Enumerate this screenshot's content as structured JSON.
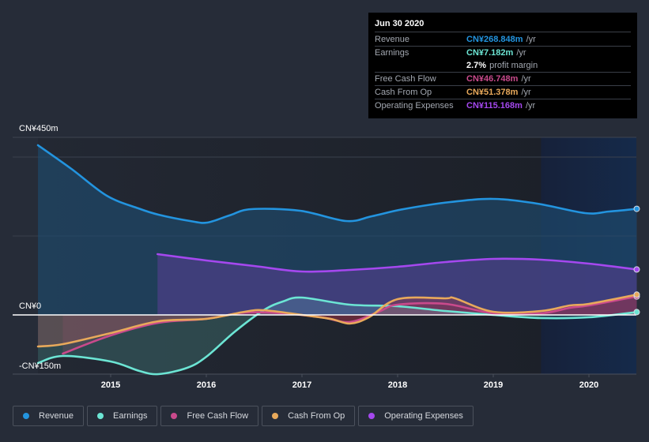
{
  "tooltip": {
    "date": "Jun 30 2020",
    "rows": [
      {
        "label": "Revenue",
        "value": "CN¥268.848m",
        "unit": "/yr",
        "color": "#2394df"
      },
      {
        "label": "Earnings",
        "value": "CN¥7.182m",
        "unit": "/yr",
        "color": "#6ce5d4"
      },
      {
        "label": "",
        "value": "2.7%",
        "unit": "profit margin",
        "color": "#ffffff"
      },
      {
        "label": "Free Cash Flow",
        "value": "CN¥46.748m",
        "unit": "/yr",
        "color": "#c94a8c"
      },
      {
        "label": "Cash From Op",
        "value": "CN¥51.378m",
        "unit": "/yr",
        "color": "#e8a95b"
      },
      {
        "label": "Operating Expenses",
        "value": "CN¥115.168m",
        "unit": "/yr",
        "color": "#a548ef"
      }
    ]
  },
  "legend": [
    {
      "label": "Revenue",
      "color": "#2394df"
    },
    {
      "label": "Earnings",
      "color": "#6ce5d4"
    },
    {
      "label": "Free Cash Flow",
      "color": "#c94a8c"
    },
    {
      "label": "Cash From Op",
      "color": "#e8a95b"
    },
    {
      "label": "Operating Expenses",
      "color": "#a548ef"
    }
  ],
  "chart_data": {
    "type": "area",
    "title": "",
    "xlabel": "",
    "ylabel": "",
    "x_ticks": [
      "2015",
      "2016",
      "2017",
      "2018",
      "2019",
      "2020"
    ],
    "y_tick_labels": [
      "CN¥450m",
      "CN¥0",
      "-CN¥150m"
    ],
    "y_ticks_values": [
      450,
      0,
      -150
    ],
    "y_gridlines": [
      450,
      400,
      200,
      0
    ],
    "xlim": [
      2014.24,
      2020.5
    ],
    "ylim": [
      -150,
      450
    ],
    "highlight_range": [
      2019.5,
      2020.5
    ],
    "units": "CN¥ millions (trailing 12 months)",
    "series": [
      {
        "name": "Revenue",
        "color": "#2394df",
        "fill": "#1f4b6e",
        "x": [
          2014.24,
          2014.59,
          2014.96,
          2015.29,
          2015.5,
          2015.83,
          2016.01,
          2016.24,
          2016.47,
          2016.98,
          2017.46,
          2017.73,
          2018.06,
          2018.55,
          2019.0,
          2019.46,
          2019.96,
          2020.21,
          2020.5
        ],
        "values": [
          430,
          370,
          302,
          270,
          254,
          238,
          234,
          252,
          268,
          264,
          238,
          250,
          268,
          286,
          294,
          282,
          258,
          262,
          268.848
        ]
      },
      {
        "name": "Operating Expenses",
        "color": "#a548ef",
        "fill": "#4a3a7a",
        "x": [
          2015.49,
          2016.0,
          2016.5,
          2017.0,
          2017.5,
          2018.0,
          2018.5,
          2019.0,
          2019.5,
          2020.0,
          2020.5
        ],
        "values": [
          154,
          138,
          124,
          110,
          114,
          122,
          134,
          142,
          140,
          130,
          115.168
        ]
      },
      {
        "name": "Earnings",
        "color": "#6ce5d4",
        "fill": "#5a8a9a",
        "x": [
          2014.24,
          2014.5,
          2015.0,
          2015.3,
          2015.5,
          2015.8,
          2016.0,
          2016.3,
          2016.6,
          2016.8,
          2017.0,
          2017.5,
          2018.0,
          2018.5,
          2019.0,
          2019.5,
          2020.0,
          2020.5
        ],
        "values": [
          -122,
          -104,
          -118,
          -142,
          -150,
          -134,
          -106,
          -42,
          12,
          34,
          44,
          26,
          22,
          10,
          0,
          -8,
          -6,
          7.182
        ]
      },
      {
        "name": "Free Cash Flow",
        "color": "#c94a8c",
        "fill": "#7a2a3a",
        "x": [
          2014.5,
          2015.0,
          2015.5,
          2016.0,
          2016.4,
          2016.8,
          2017.2,
          2017.5,
          2017.8,
          2018.0,
          2018.5,
          2019.0,
          2019.5,
          2019.8,
          2020.0,
          2020.5
        ],
        "values": [
          -98,
          -52,
          -20,
          -10,
          6,
          4,
          -6,
          -18,
          8,
          26,
          28,
          4,
          4,
          18,
          24,
          46.748
        ]
      },
      {
        "name": "Cash From Op",
        "color": "#e8a95b",
        "fill": "#8a3a3a",
        "x": [
          2014.24,
          2014.5,
          2015.0,
          2015.5,
          2016.0,
          2016.4,
          2016.6,
          2017.0,
          2017.3,
          2017.5,
          2017.7,
          2018.0,
          2018.5,
          2018.6,
          2019.0,
          2019.5,
          2019.8,
          2020.0,
          2020.5
        ],
        "values": [
          -80,
          -74,
          -46,
          -16,
          -10,
          8,
          12,
          0,
          -10,
          -22,
          -6,
          40,
          42,
          42,
          8,
          10,
          24,
          28,
          51.378
        ]
      }
    ]
  }
}
